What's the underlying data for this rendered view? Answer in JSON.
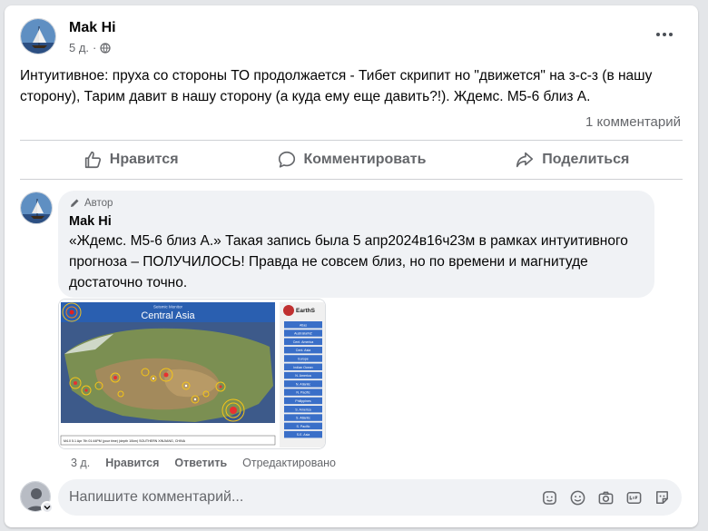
{
  "post": {
    "author": "Mak Hi",
    "time": "5 д.",
    "privacy_icon": "globe-icon",
    "text": "Интуитивное: пруха со стороны ТО продолжается - Тибет скрипит но \"движется\" на з-с-з (в нашу сторону), Тарим давит в нашу сторону (а куда ему еще давить?!). Ждемс. М5-6 близ А.",
    "comments_count": "1 комментарий"
  },
  "actions": {
    "like": "Нравится",
    "comment": "Комментировать",
    "share": "Поделиться"
  },
  "comment": {
    "badge": "Автор",
    "author": "Mak Hi",
    "text": "«Ждемс. М5-6 близ А.» Такая запись была 5 апр2024в16ч23м в рамках интуитивного прогноза – ПОЛУЧИЛОСЬ! Правда не совсем близ, но по времени и магнитуде достаточно точно.",
    "image": {
      "title_small": "Seismic Monitor",
      "title": "Central Asia",
      "logo": "EarthS",
      "caption": "M4.0 5.1 Apr 7th 01:44PM (your time) (depth 10km) SOUTHERN XINJIANG, CHINA",
      "regions": [
        "Atlas",
        "Australia/NZ",
        "Cent. America",
        "Cent. Asia",
        "Europe",
        "Indian Ocean",
        "N. America",
        "N. Atlantic",
        "N. Pacific",
        "Philippines",
        "S. America",
        "S. Atlantic",
        "S. Pacific",
        "S.E. Asia"
      ]
    },
    "time": "3 д.",
    "like": "Нравится",
    "reply": "Ответить",
    "edited": "Отредактировано"
  },
  "reply_box": {
    "placeholder": "Напишите комментарий..."
  },
  "colors": {
    "secondary_text": "#65676b",
    "bubble": "#f0f2f5",
    "accent": "#1877f2"
  }
}
